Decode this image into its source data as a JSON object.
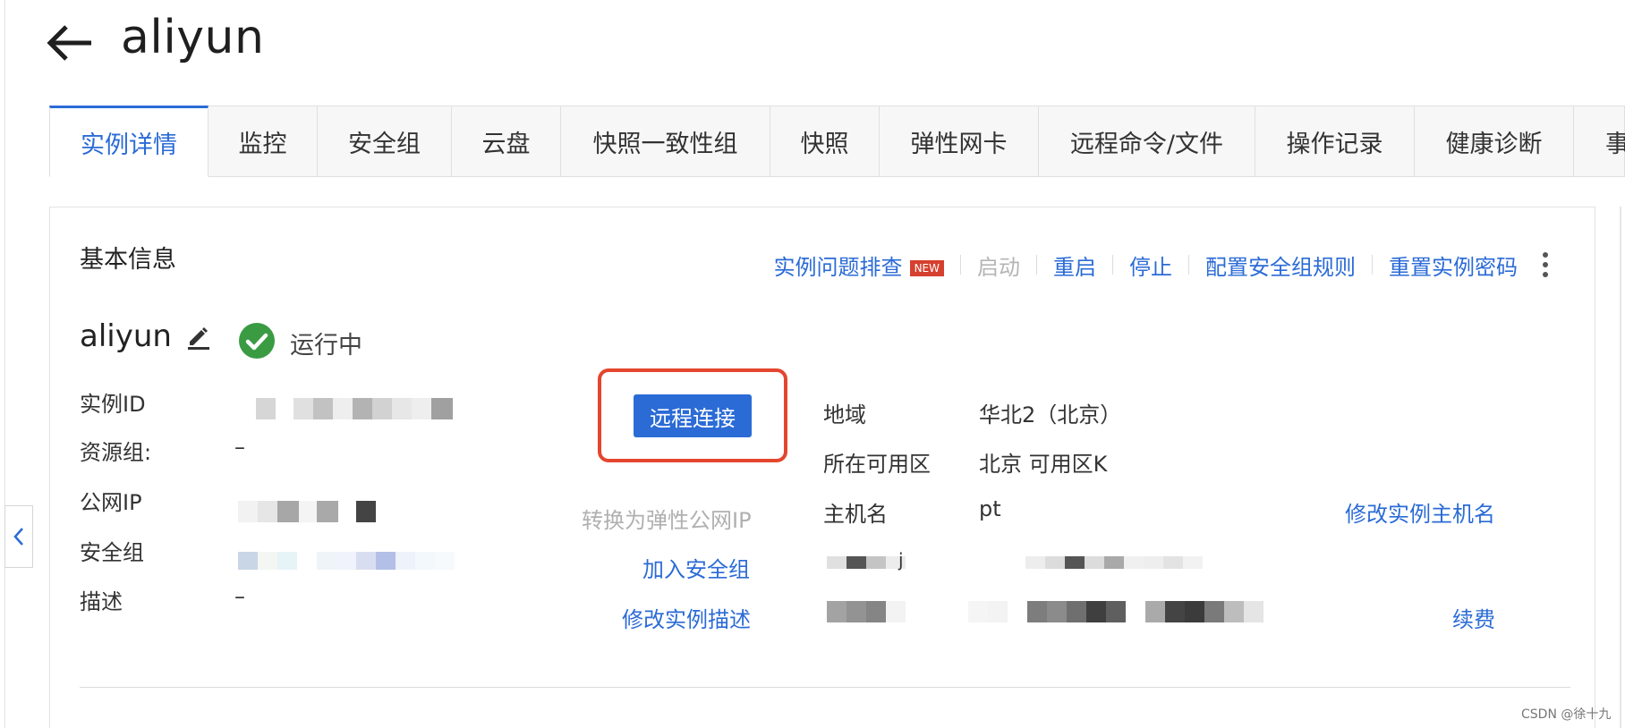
{
  "header": {
    "title": "aliyun"
  },
  "tabs": [
    {
      "label": "实例详情",
      "active": true
    },
    {
      "label": "监控"
    },
    {
      "label": "安全组"
    },
    {
      "label": "云盘"
    },
    {
      "label": "快照一致性组"
    },
    {
      "label": "快照"
    },
    {
      "label": "弹性网卡"
    },
    {
      "label": "远程命令/文件"
    },
    {
      "label": "操作记录"
    },
    {
      "label": "健康诊断"
    },
    {
      "label": "事"
    }
  ],
  "card": {
    "title": "基本信息",
    "actions": {
      "troubleshoot": "实例问题排查",
      "new_badge": "NEW",
      "start": "启动",
      "restart": "重启",
      "stop": "停止",
      "config_sg_rules": "配置安全组规则",
      "reset_password": "重置实例密码"
    },
    "instance": {
      "name": "aliyun",
      "status": "运行中",
      "status_color": "#3a9b43"
    },
    "remote_connect_label": "远程连接",
    "left_fields": {
      "instance_id": "实例ID",
      "resource_group": "资源组:",
      "resource_group_value": "–",
      "public_ip": "公网IP",
      "public_ip_action": "转换为弹性公网IP",
      "security_group": "安全组",
      "security_group_action": "加入安全组",
      "description": "描述",
      "description_value": "–",
      "description_action": "修改实例描述"
    },
    "right_fields": {
      "region": "地域",
      "region_value": "华北2（北京）",
      "zone": "所在可用区",
      "zone_value": "北京 可用区K",
      "hostname": "主机名",
      "hostname_value": "pt",
      "hostname_action": "修改实例主机名",
      "row4_label_fragment": "j",
      "renew_action": "续费"
    }
  },
  "watermark": "CSDN @徐十九",
  "colors": {
    "accent": "#2b6bd6",
    "highlight": "#e4462e",
    "badge": "#d6402f"
  }
}
